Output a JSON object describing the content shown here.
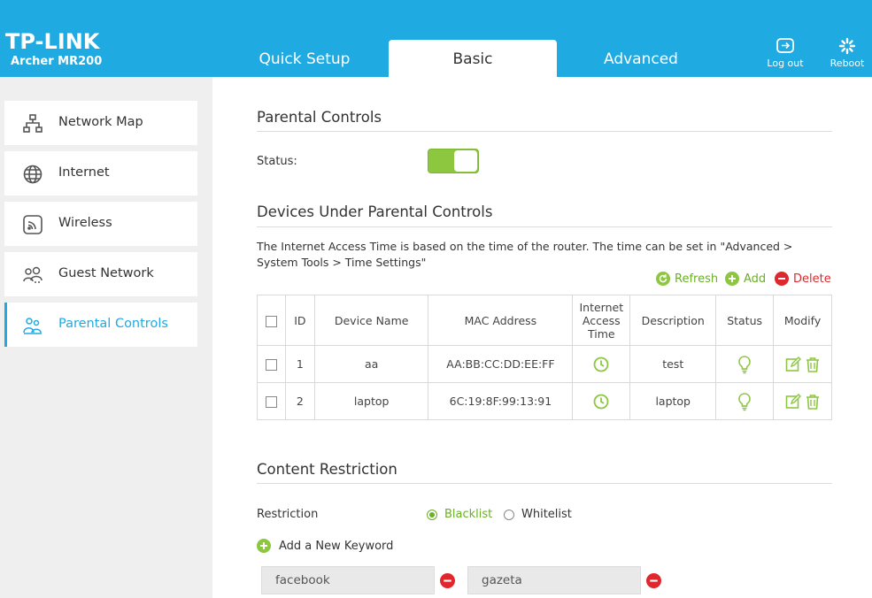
{
  "brand": {
    "logo": "TP-LINK",
    "model": "Archer MR200"
  },
  "tabs": [
    {
      "label": "Quick Setup"
    },
    {
      "label": "Basic"
    },
    {
      "label": "Advanced"
    }
  ],
  "header_buttons": {
    "logout": "Log out",
    "reboot": "Reboot"
  },
  "sidebar": {
    "items": [
      {
        "label": "Network Map",
        "icon": "network-map-icon"
      },
      {
        "label": "Internet",
        "icon": "globe-icon"
      },
      {
        "label": "Wireless",
        "icon": "wireless-icon"
      },
      {
        "label": "Guest Network",
        "icon": "guest-network-icon"
      },
      {
        "label": "Parental Controls",
        "icon": "parental-controls-icon",
        "active": true
      }
    ]
  },
  "parental": {
    "title": "Parental Controls",
    "status_label": "Status:",
    "status_on": true
  },
  "devices": {
    "title": "Devices Under Parental Controls",
    "note": "The Internet Access Time is based on the time of the router. The time can be set in \"Advanced > System Tools > Time Settings\"",
    "actions": {
      "refresh": "Refresh",
      "add": "Add",
      "delete": "Delete"
    },
    "columns": [
      "ID",
      "Device Name",
      "MAC Address",
      "Internet Access Time",
      "Description",
      "Status",
      "Modify"
    ],
    "rows": [
      {
        "id": "1",
        "name": "aa",
        "mac": "AA:BB:CC:DD:EE:FF",
        "description": "test"
      },
      {
        "id": "2",
        "name": "laptop",
        "mac": "6C:19:8F:99:13:91",
        "description": "laptop"
      }
    ]
  },
  "content": {
    "title": "Content Restriction",
    "restriction_label": "Restriction",
    "options": [
      "Blacklist",
      "Whitelist"
    ],
    "selected": "Blacklist",
    "add_keyword": "Add a New Keyword",
    "keywords": [
      "facebook",
      "gazeta"
    ]
  },
  "colors": {
    "accent": "#1faae2",
    "green": "#8dc63f",
    "red": "#e0272d"
  }
}
